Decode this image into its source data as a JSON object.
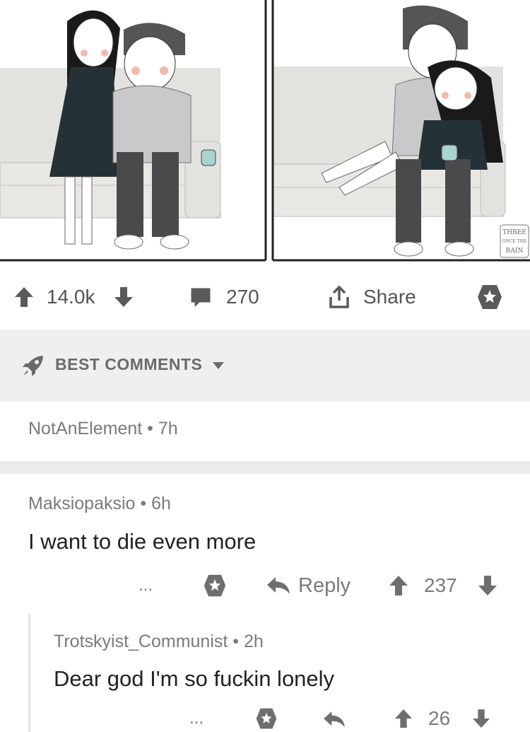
{
  "post": {
    "upvotes": "14.0k",
    "comments": "270",
    "share_label": "Share",
    "comic_signature": "THREE ONCE THE RAIN"
  },
  "sort": {
    "label": "BEST COMMENTS"
  },
  "comments": [
    {
      "author": "NotAnElement",
      "age": "7h"
    },
    {
      "author": "Maksiopaksio",
      "age": "6h",
      "body": "I want to die even more",
      "more": "...",
      "reply_label": "Reply",
      "score": "237"
    },
    {
      "author": "Trotskyist_Communist",
      "age": "2h",
      "body": "Dear god I'm so fuckin lonely",
      "more": "...",
      "score": "26"
    }
  ],
  "colors": {
    "sorter_bg": "#efeff1",
    "text_muted": "#7a7a7a",
    "icon": "#5a5a5a"
  }
}
